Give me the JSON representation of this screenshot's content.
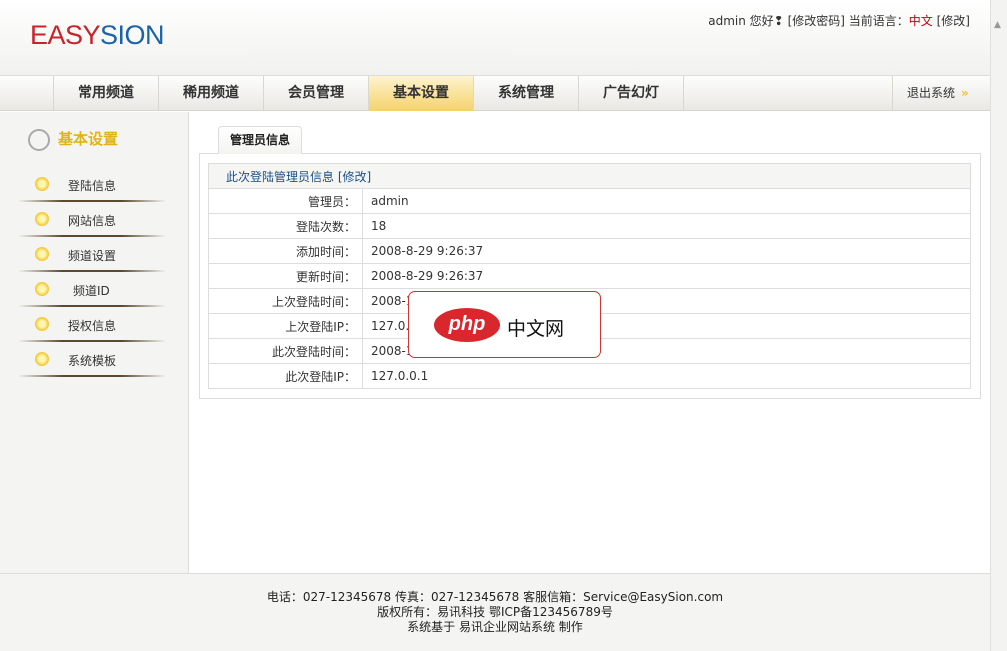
{
  "header": {
    "logo_a": "EASY",
    "logo_b": "SION",
    "greeting": "admin 您好❢",
    "change_password": "[修改密码]",
    "lang_label": "当前语言：",
    "lang": "中文",
    "lang_edit": "[修改]"
  },
  "nav": {
    "items": [
      "常用频道",
      "稀用频道",
      "会员管理",
      "基本设置",
      "系统管理",
      "广告幻灯"
    ],
    "active": "基本设置",
    "logout": "退出系统"
  },
  "sidebar": {
    "title": "基本设置",
    "items": [
      "登陆信息",
      "网站信息",
      "频道设置",
      "频道ID",
      "授权信息",
      "系统模板"
    ]
  },
  "main": {
    "tab": "管理员信息",
    "table_head": "此次登陆管理员信息 [修改]",
    "rows": [
      {
        "label": "管理员：",
        "value": "admin"
      },
      {
        "label": "登陆次数：",
        "value": "18"
      },
      {
        "label": "添加时间：",
        "value": "2008-8-29 9:26:37"
      },
      {
        "label": "更新时间：",
        "value": "2008-8-29 9:26:37"
      },
      {
        "label": "上次登陆时间：",
        "value": "2008-1"
      },
      {
        "label": "上次登陆IP：",
        "value": "127.0."
      },
      {
        "label": "此次登陆时间：",
        "value": "2008-1"
      },
      {
        "label": "此次登陆IP：",
        "value": "127.0.0.1"
      }
    ]
  },
  "watermark": {
    "php": "php",
    "cn": "中文网"
  },
  "footer": {
    "line1": "电话：027-12345678 传真：027-12345678 客服信箱：Service@EasySion.com",
    "line2": "版权所有：易讯科技 鄂ICP备123456789号",
    "line3": "系统基于 易讯企业网站系统 制作"
  }
}
